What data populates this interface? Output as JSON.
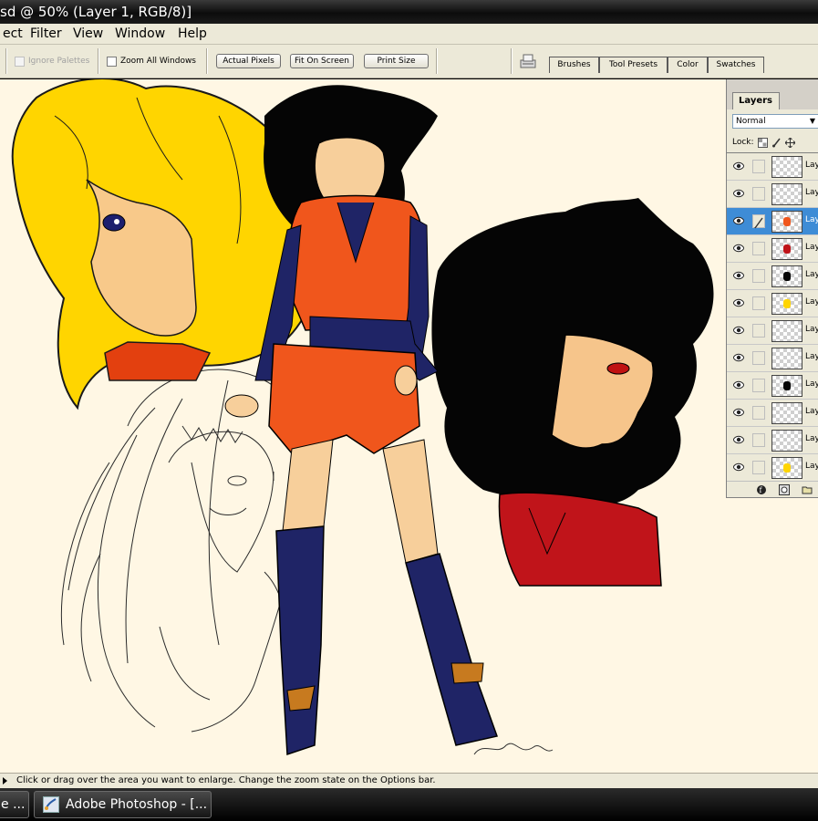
{
  "window": {
    "title": "sd @ 50% (Layer 1, RGB/8)]"
  },
  "menubar": {
    "items": [
      "ect",
      "Filter",
      "View",
      "Window",
      "Help"
    ]
  },
  "options": {
    "ignore_palettes": "Ignore Palettes",
    "zoom_all_windows": "Zoom All Windows",
    "actual_pixels": "Actual Pixels",
    "fit_on_screen": "Fit On Screen",
    "print_size": "Print Size"
  },
  "palette_well": {
    "tabs": [
      "Brushes",
      "Tool Presets",
      "Color",
      "Swatches"
    ]
  },
  "layers_panel": {
    "tab": "Layers",
    "blend_mode": "Normal",
    "lock_label": "Lock:",
    "layers": [
      {
        "name": "Lay",
        "visible": true,
        "selected": false
      },
      {
        "name": "Lay",
        "visible": true,
        "selected": false
      },
      {
        "name": "Lay",
        "visible": true,
        "selected": true
      },
      {
        "name": "Lay",
        "visible": true,
        "selected": false
      },
      {
        "name": "Lay",
        "visible": true,
        "selected": false
      },
      {
        "name": "Lay",
        "visible": true,
        "selected": false
      },
      {
        "name": "Lay",
        "visible": true,
        "selected": false
      },
      {
        "name": "Lay",
        "visible": true,
        "selected": false
      },
      {
        "name": "Lay",
        "visible": true,
        "selected": false
      },
      {
        "name": "Lay",
        "visible": true,
        "selected": false
      },
      {
        "name": "Lay",
        "visible": true,
        "selected": false
      },
      {
        "name": "Lay",
        "visible": true,
        "selected": false
      }
    ]
  },
  "status": {
    "text": "Click or drag over the area you want to enlarge. Change the zoom state on the Options bar."
  },
  "taskbar": {
    "left_fragment": "e ...",
    "photoshop_button": "Adobe Photoshop - [..."
  },
  "colors": {
    "canvas_bg": "#fff7e4",
    "selection": "#3e8cd6",
    "gi_orange": "#f0561c",
    "gi_navy": "#1f2466",
    "blonde": "#ffd500"
  }
}
